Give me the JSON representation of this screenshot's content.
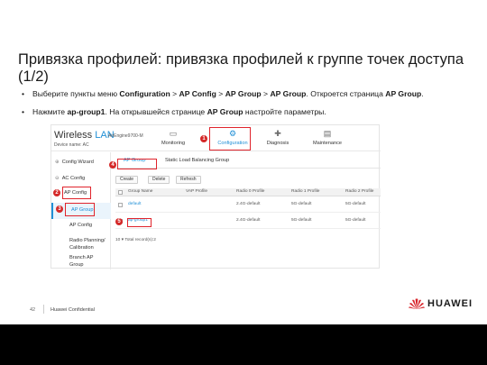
{
  "slide": {
    "title": "Привязка профилей: привязка профилей к группе точек доступа (1/2)",
    "bullets": [
      {
        "marker": "•",
        "parts": [
          "Выберите пункты меню ",
          "Configuration",
          " > ",
          "AP Config",
          " > ",
          "AP Group",
          " > ",
          "AP Group",
          ". Откроется страница ",
          "AP Group",
          "."
        ]
      },
      {
        "marker": "•",
        "parts": [
          "Нажмите ",
          "ap-group1",
          ". На открывшейся странице ",
          "AP Group",
          " настройте параметры."
        ]
      }
    ],
    "page_number": "42",
    "confidential": "Huawei Confidential",
    "logo_text": "HUAWEI"
  },
  "app": {
    "brand_prefix": "Wireless ",
    "brand_suffix": "LAN",
    "model": "AirEngine9700-M",
    "device_name": "Device name:  AC",
    "nav": [
      {
        "label": "Monitoring",
        "icon": "monitoring-icon",
        "glyph": "▭"
      },
      {
        "label": "Configuration",
        "icon": "gear-icon",
        "glyph": "⚙"
      },
      {
        "label": "Diagnosis",
        "icon": "diagnosis-icon",
        "glyph": "✚"
      },
      {
        "label": "Maintenance",
        "icon": "maintenance-icon",
        "glyph": "▤"
      }
    ],
    "sidebar": [
      {
        "prefix": "⊕",
        "label": "Config Wizard"
      },
      {
        "prefix": "⊖",
        "label": "AC Config"
      },
      {
        "prefix": "",
        "label": "AP Config"
      },
      {
        "prefix": "",
        "label": "AP Group"
      },
      {
        "prefix": "",
        "label": "AP Config"
      },
      {
        "prefix": "",
        "label": "Radio Planning/"
      },
      {
        "prefix": "",
        "label": "Calibration"
      },
      {
        "prefix": "",
        "label": "Branch AP"
      },
      {
        "prefix": "",
        "label": "Group"
      }
    ],
    "tabs": [
      "AP Group",
      "Static Load Balancing Group"
    ],
    "buttons": [
      "Create",
      "Delete",
      "Refresh"
    ],
    "table": {
      "headers": [
        "Group Name",
        "VAP Profile",
        "Radio 0 Profile",
        "Radio 1 Profile",
        "Radio 2 Profile"
      ],
      "rows": [
        [
          "default",
          "",
          "2.4G-default",
          "5G-default",
          "5G-default"
        ],
        [
          "ap-group1",
          "",
          "2.4G-default",
          "5G-default",
          "5G-default"
        ]
      ],
      "pager": "10 ▾   Total record(s):2"
    },
    "markers": [
      "1",
      "2",
      "3",
      "4",
      "5"
    ],
    "colors": {
      "accent": "#1f8fd6",
      "highlight": "#e0242c",
      "marker": "#d42828"
    }
  }
}
